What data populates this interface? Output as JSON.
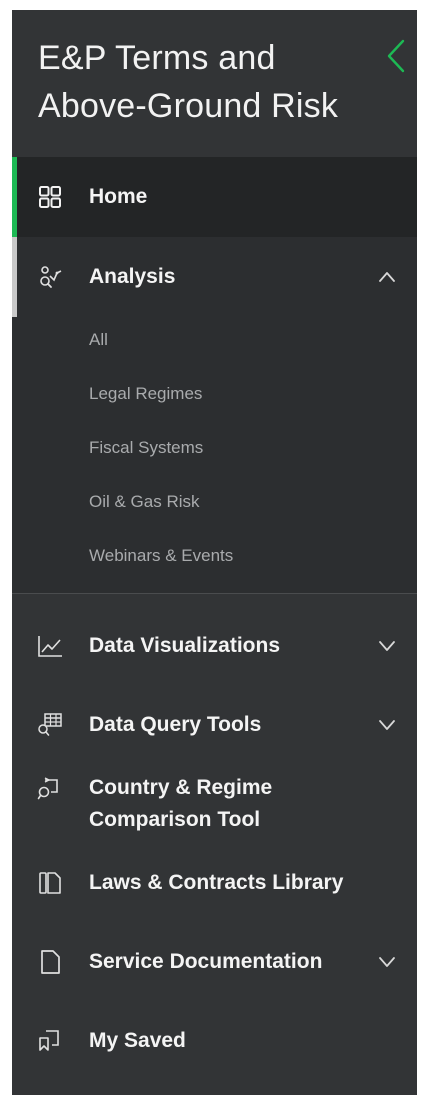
{
  "header": {
    "title": "E&P Terms and Above-Ground Risk",
    "collapse_icon": "chevron-left-icon",
    "accent_color": "#1db954"
  },
  "nav": {
    "home": {
      "label": "Home",
      "icon": "grid-icon",
      "active": true
    },
    "analysis": {
      "label": "Analysis",
      "icon": "analysis-icon",
      "expanded": true,
      "sub_items": [
        "All",
        "Legal Regimes",
        "Fiscal Systems",
        "Oil & Gas Risk",
        "Webinars & Events"
      ]
    },
    "data_visualizations": {
      "label": "Data Visualizations",
      "icon": "line-chart-icon",
      "expandable": true
    },
    "data_query_tools": {
      "label": "Data Query Tools",
      "icon": "query-table-icon",
      "expandable": true
    },
    "comparison_tool": {
      "label_line1": "Country & Regime",
      "label_line2": "Comparison Tool",
      "icon": "comparison-icon"
    },
    "laws_library": {
      "label": "Laws & Contracts Library",
      "icon": "library-icon"
    },
    "service_docs": {
      "label": "Service Documentation",
      "icon": "document-icon",
      "expandable": true
    },
    "my_saved": {
      "label": "My Saved",
      "icon": "saved-icon"
    }
  },
  "colors": {
    "sidebar_bg": "#323436",
    "active_row_bg": "#232526",
    "active_indicator": "#1db954",
    "submenu_text": "#a9abad"
  }
}
